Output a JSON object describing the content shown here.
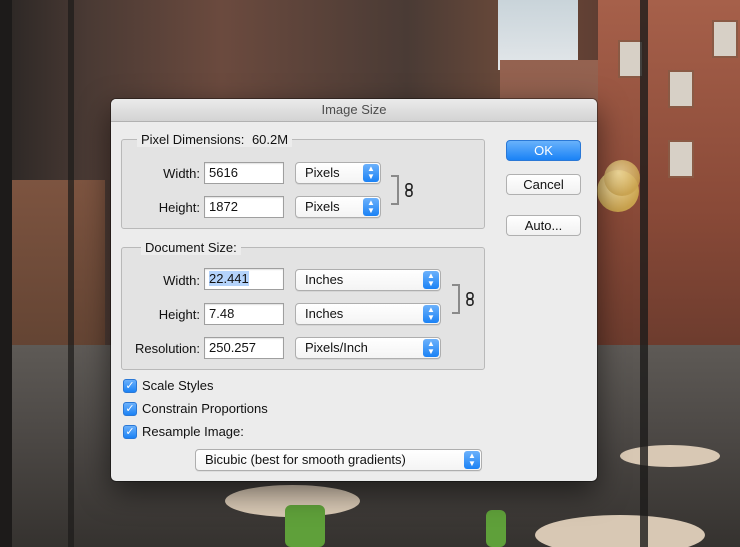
{
  "dialog": {
    "title": "Image Size"
  },
  "pixel_dimensions": {
    "title": "Pixel Dimensions:",
    "size": "60.2M",
    "width_label": "Width:",
    "width_value": "5616",
    "width_unit": "Pixels",
    "height_label": "Height:",
    "height_value": "1872",
    "height_unit": "Pixels"
  },
  "document_size": {
    "title": "Document Size:",
    "width_label": "Width:",
    "width_value": "22.441",
    "width_unit": "Inches",
    "height_label": "Height:",
    "height_value": "7.48",
    "height_unit": "Inches",
    "resolution_label": "Resolution:",
    "resolution_value": "250.257",
    "resolution_unit": "Pixels/Inch"
  },
  "options": {
    "scale_styles": {
      "label": "Scale Styles",
      "checked": true
    },
    "constrain_proportions": {
      "label": "Constrain Proportions",
      "checked": true
    },
    "resample_image": {
      "label": "Resample Image:",
      "checked": true
    },
    "resample_method": "Bicubic (best for smooth gradients)"
  },
  "buttons": {
    "ok": "OK",
    "cancel": "Cancel",
    "auto": "Auto..."
  },
  "icons": {
    "chain": "chain-link-icon",
    "popup_arrows": "up-down-chevron-icon",
    "checkmark": "checkmark-icon"
  },
  "colors": {
    "accent": "#1b82f5",
    "selection": "#b4d3fb"
  }
}
